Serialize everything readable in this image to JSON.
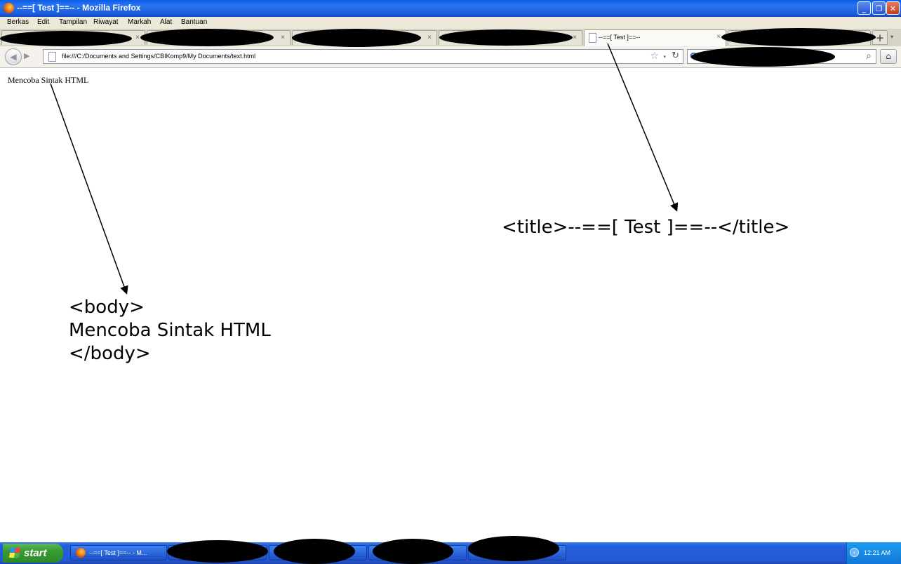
{
  "window": {
    "title": "--==[ Test ]==-- - Mozilla Firefox",
    "buttons": {
      "minimize": "_",
      "restore": "❐",
      "close": "✕"
    }
  },
  "menubar": {
    "items": [
      "Berkas",
      "Edit",
      "Tampilan",
      "Riwayat",
      "Markah",
      "Alat",
      "Bantuan"
    ]
  },
  "tabs": {
    "active_label": "--==[ Test ]==--",
    "close_glyph": "×",
    "new_tab_glyph": "+",
    "list_glyph": "▾"
  },
  "navbar": {
    "back_glyph": "◀",
    "forward_glyph": "▶",
    "url": "file:///C:/Documents and Settings/CBIKomp9/My Documents/text.html",
    "star_glyph": "☆",
    "dropdown_glyph": "▾",
    "reload_glyph": "↻",
    "search_logo": "G",
    "search_glyph": "⌕",
    "home_glyph": "⌂"
  },
  "page": {
    "body_text": "Mencoba Sintak HTML"
  },
  "annotations": {
    "title_tag": "<title>--==[ Test ]==--</title>",
    "body_lines": [
      "<body>",
      "Mencoba Sintak HTML",
      "</body>"
    ]
  },
  "taskbar": {
    "start_label": "start",
    "firefox_task": "--==[ Test ]==-- - M...",
    "tray_chevron": "‹",
    "clock": "12:21 AM"
  },
  "colors": {
    "titlebar_blue": "#0a5de8",
    "taskbar_blue": "#245edb",
    "start_green": "#379b34",
    "chrome_gray": "#ece9d8"
  }
}
